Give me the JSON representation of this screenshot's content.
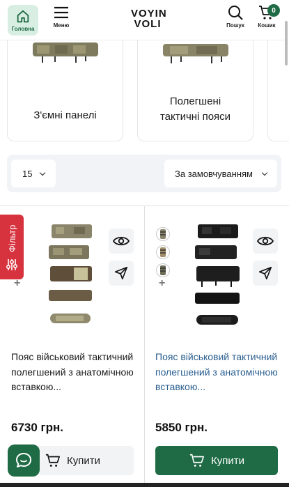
{
  "header": {
    "home_label": "Головна",
    "menu_label": "Меню",
    "logo_text_1": "VOYIN",
    "logo_text_2": "VOLI",
    "search_label": "Пошук",
    "cart_label": "Кошик",
    "cart_count": "0"
  },
  "categories": [
    {
      "label": "З'ємні панелі"
    },
    {
      "label_line1": "Полегшені",
      "label_line2": "тактичні пояси"
    }
  ],
  "filters": {
    "per_page": "15",
    "sort": "За замовчуванням"
  },
  "filter_tab": {
    "label": "Фільтр"
  },
  "products": [
    {
      "title": "Пояс військовий тактичний полегшений з анатомічною вставкою...",
      "price": "6730 грн.",
      "buy_label": "Купити"
    },
    {
      "title": "Пояс військовий тактичний полегшений з анатомічною вставкою...",
      "price": "5850 грн.",
      "buy_label": "Купити"
    }
  ],
  "colors": {
    "brand_green": "#1f6b45",
    "filter_red": "#d6333f",
    "link_blue": "#2a5e8f"
  },
  "icons": [
    "home-icon",
    "menu-icon",
    "search-icon",
    "cart-icon",
    "eye-icon",
    "share-icon",
    "filter-sliders-icon",
    "chat-icon"
  ]
}
